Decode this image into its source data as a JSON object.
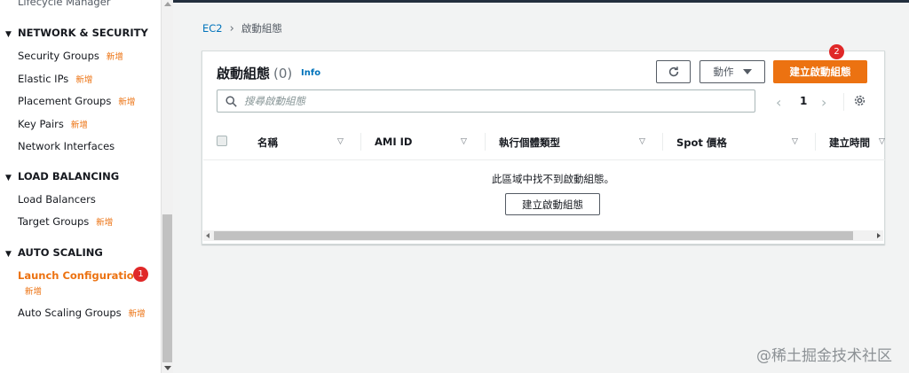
{
  "colors": {
    "accent": "#ec7211",
    "link": "#0073bb",
    "badge": "#e02828"
  },
  "sidebar": {
    "top_partial": "Lifecycle Manager",
    "new_tag": "新增",
    "sections": {
      "network": {
        "title": "NETWORK & SECURITY"
      },
      "load_balancing": {
        "title": "LOAD BALANCING"
      },
      "auto_scaling": {
        "title": "AUTO SCALING"
      }
    },
    "items": {
      "security_groups": "Security Groups",
      "elastic_ips": "Elastic IPs",
      "placement_groups": "Placement Groups",
      "key_pairs": "Key Pairs",
      "network_interfaces": "Network Interfaces",
      "load_balancers": "Load Balancers",
      "target_groups": "Target Groups",
      "launch_configurations": "Launch Configurations",
      "auto_scaling_groups": "Auto Scaling Groups"
    },
    "badge_1": "1"
  },
  "breadcrumb": {
    "root": "EC2",
    "current": "啟動組態"
  },
  "panel": {
    "title": "啟動組態",
    "count": "(0)",
    "info": "Info",
    "actions_label": "動作",
    "create_label": "建立啟動組態",
    "badge_2": "2",
    "search_placeholder": "搜尋啟動組態",
    "page_number": "1",
    "columns": [
      "名稱",
      "AMI ID",
      "執行個體類型",
      "Spot 價格",
      "建立時間"
    ],
    "empty_message": "此區域中找不到啟動組態。",
    "empty_create_label": "建立啟動組態"
  },
  "watermark": "@稀土掘金技术社区"
}
